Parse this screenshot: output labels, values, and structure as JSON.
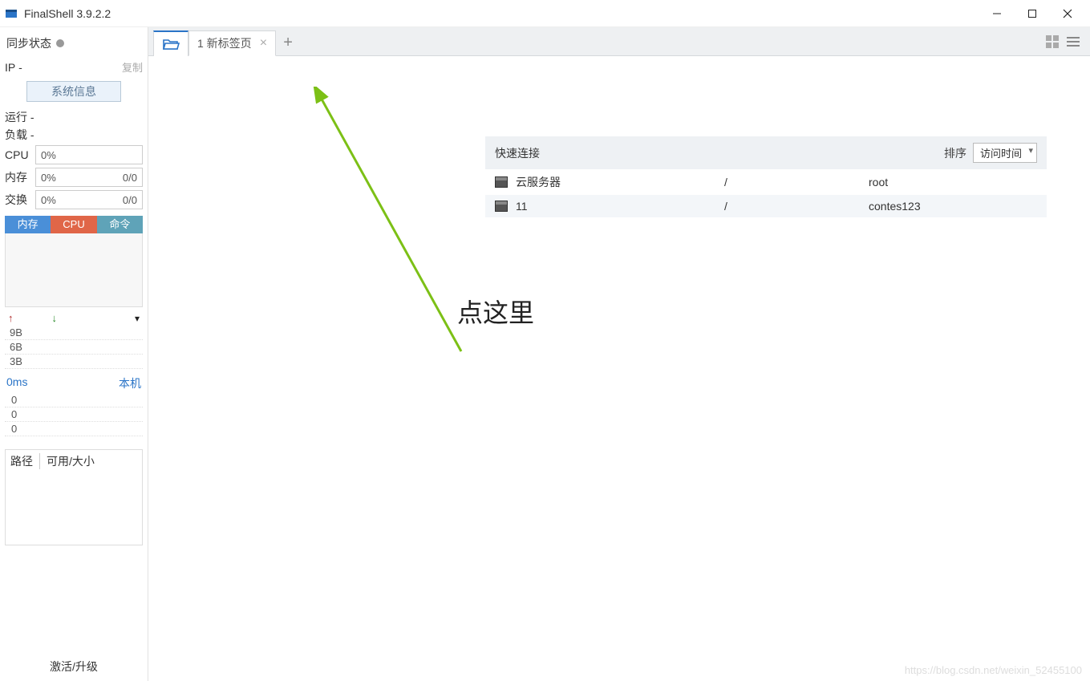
{
  "titlebar": {
    "title": "FinalShell 3.9.2.2"
  },
  "sidebar": {
    "sync_label": "同步状态",
    "ip_label": "IP",
    "ip_val": "-",
    "copy": "复制",
    "sysinfo": "系统信息",
    "run_label": "运行",
    "run_val": "-",
    "load_label": "负载",
    "load_val": "-",
    "cpu_label": "CPU",
    "cpu_val": "0%",
    "mem_label": "内存",
    "mem_val": "0%",
    "mem_r": "0/0",
    "swap_label": "交换",
    "swap_val": "0%",
    "swap_r": "0/0",
    "tabs": {
      "mem": "内存",
      "cpu": "CPU",
      "cmd": "命令"
    },
    "net": {
      "l1": "9B",
      "l2": "6B",
      "l3": "3B"
    },
    "ping": {
      "ms": "0ms",
      "local": "本机",
      "z1": "0",
      "z2": "0",
      "z3": "0"
    },
    "path_hdr": {
      "c1": "路径",
      "c2": "可用/大小"
    },
    "activate": "激活/升级"
  },
  "tabbar": {
    "tab1": "1 新标签页"
  },
  "quick": {
    "title": "快速连接",
    "sort_label": "排序",
    "sort_value": "访问时间",
    "rows": [
      {
        "name": "云服务器",
        "path": "/",
        "user": "root"
      },
      {
        "name": "11",
        "path": "/",
        "user": "contes123"
      }
    ]
  },
  "annotation": "点这里",
  "watermark": "https://blog.csdn.net/weixin_52455100"
}
